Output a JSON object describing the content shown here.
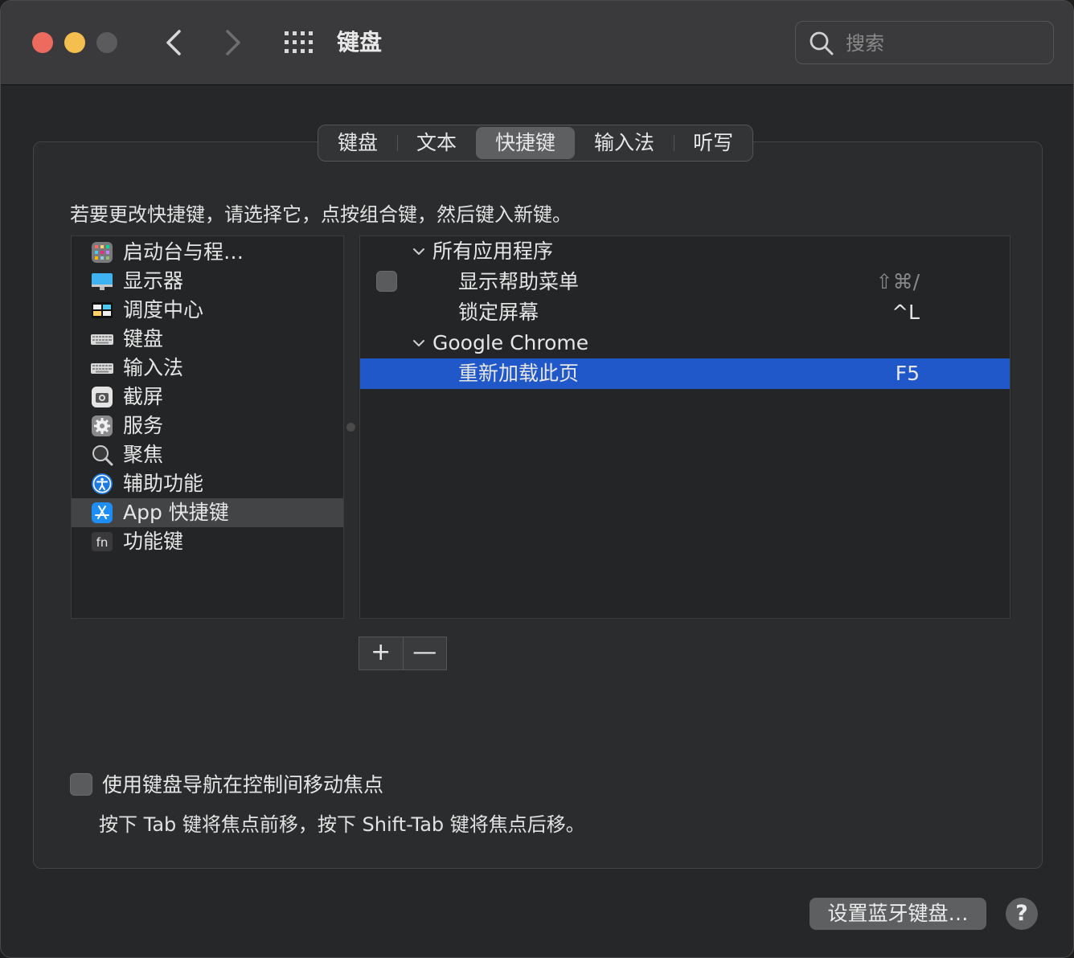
{
  "window": {
    "title": "键盘",
    "search": {
      "placeholder": "搜索",
      "value": ""
    }
  },
  "tabs": [
    {
      "label": "键盘",
      "active": false
    },
    {
      "label": "文本",
      "active": false
    },
    {
      "label": "快捷键",
      "active": true
    },
    {
      "label": "输入法",
      "active": false
    },
    {
      "label": "听写",
      "active": false
    }
  ],
  "instruction": "若要更改快捷键，请选择它，点按组合键，然后键入新键。",
  "categories": [
    {
      "label": "启动台与程…",
      "icon": "launchpad-icon"
    },
    {
      "label": "显示器",
      "icon": "display-icon"
    },
    {
      "label": "调度中心",
      "icon": "mission-control-icon"
    },
    {
      "label": "键盘",
      "icon": "keyboard-icon"
    },
    {
      "label": "输入法",
      "icon": "input-method-icon"
    },
    {
      "label": "截屏",
      "icon": "screenshot-icon"
    },
    {
      "label": "服务",
      "icon": "gear-icon"
    },
    {
      "label": "聚焦",
      "icon": "spotlight-icon"
    },
    {
      "label": "辅助功能",
      "icon": "accessibility-icon"
    },
    {
      "label": "App 快捷键",
      "icon": "app-store-icon",
      "selected": true
    },
    {
      "label": "功能键",
      "icon": "fn-icon"
    }
  ],
  "shortcuts": {
    "group_all": "所有应用程序",
    "show_help_menu": {
      "label": "显示帮助菜单",
      "keys": "⇧⌘/"
    },
    "lock_screen": {
      "label": "锁定屏幕",
      "keys": "^L"
    },
    "group_chrome": "Google Chrome",
    "reload_page": {
      "label": "重新加载此页",
      "keys": "F5"
    }
  },
  "buttons": {
    "add": "+",
    "remove": "—",
    "bluetooth_keyboard": "设置蓝牙键盘…",
    "help": "?"
  },
  "keyboard_nav": {
    "label": "使用键盘导航在控制间移动焦点",
    "hint": "按下 Tab 键将焦点前移，按下 Shift-Tab 键将焦点后移。",
    "checked": false
  },
  "colors": {
    "selection": "#2058c9",
    "close": "#ed6a5e",
    "minimize": "#f5bf4f"
  }
}
